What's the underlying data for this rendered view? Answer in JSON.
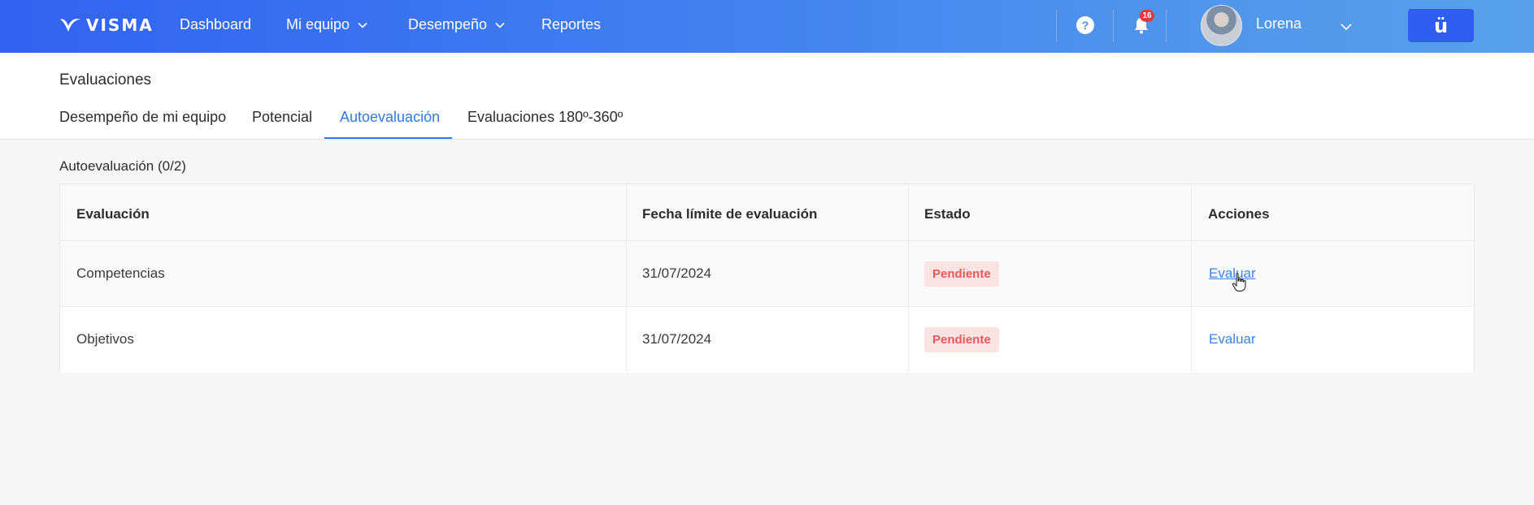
{
  "brand": {
    "name": "VISMA",
    "logo_icon": "visma-swoosh-icon"
  },
  "nav": {
    "items": [
      {
        "label": "Dashboard",
        "has_dropdown": false
      },
      {
        "label": "Mi equipo",
        "has_dropdown": true
      },
      {
        "label": "Desempeño",
        "has_dropdown": true
      },
      {
        "label": "Reportes",
        "has_dropdown": false
      }
    ],
    "help_icon": "help-icon",
    "help_glyph": "?",
    "notifications": {
      "icon": "bell-icon",
      "count": "16"
    },
    "user": {
      "name": "Lorena",
      "avatar": "user-avatar"
    },
    "app_button": {
      "label": "ü",
      "icon": "app-launcher-icon"
    }
  },
  "page": {
    "title": "Evaluaciones",
    "tabs": [
      {
        "label": "Desempeño de mi equipo",
        "active": false
      },
      {
        "label": "Potencial",
        "active": false
      },
      {
        "label": "Autoevaluación",
        "active": true
      },
      {
        "label": "Evaluaciones 180º-360º",
        "active": false
      }
    ]
  },
  "section": {
    "title": "Autoevaluación (0/2)",
    "table": {
      "columns": [
        "Evaluación",
        "Fecha límite de evaluación",
        "Estado",
        "Acciones"
      ],
      "rows": [
        {
          "evaluacion": "Competencias",
          "fecha": "31/07/2024",
          "estado": "Pendiente",
          "accion": "Evaluar"
        },
        {
          "evaluacion": "Objetivos",
          "fecha": "31/07/2024",
          "estado": "Pendiente",
          "accion": "Evaluar"
        }
      ]
    }
  },
  "colors": {
    "nav_gradient_start": "#3262f0",
    "nav_gradient_end": "#58a1ea",
    "accent": "#2f7be6",
    "badge_bg": "#fbe3e3",
    "badge_text": "#e05b5b",
    "notification_badge": "#e23a3a"
  }
}
